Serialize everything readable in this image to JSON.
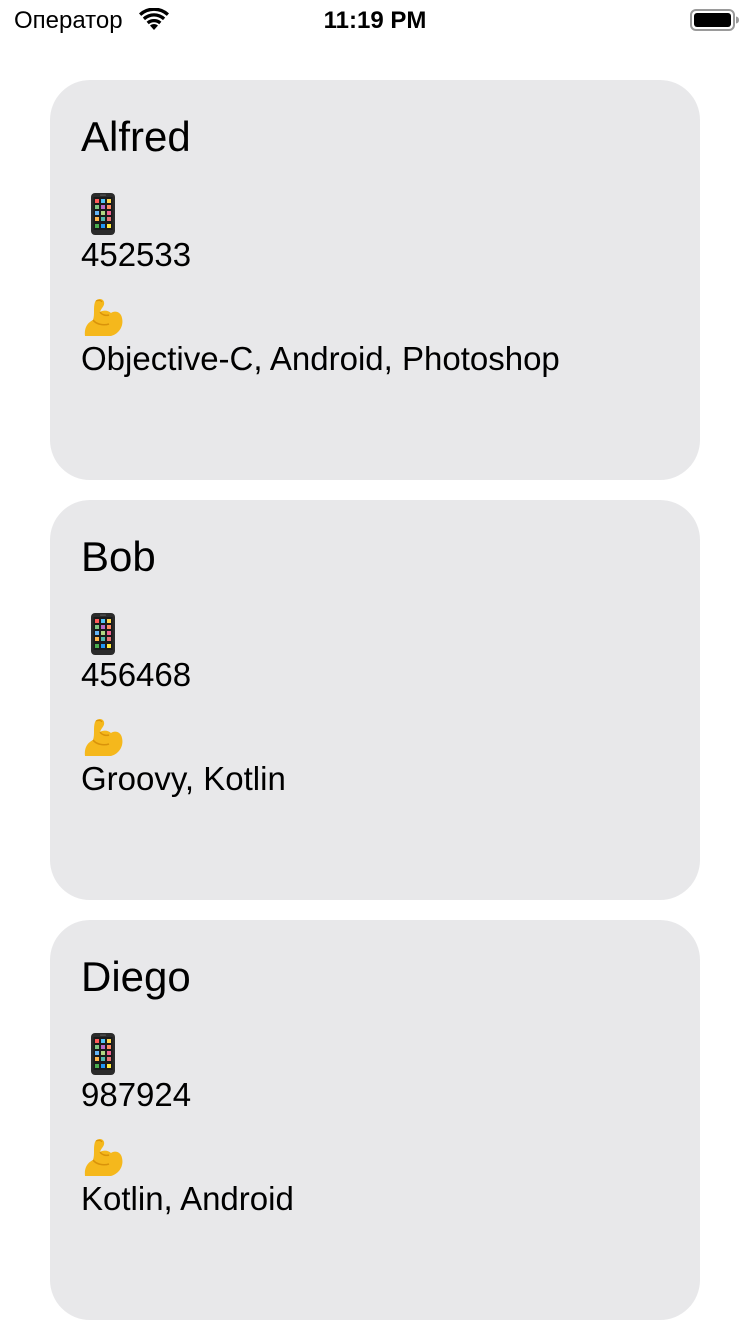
{
  "status_bar": {
    "carrier": "Оператор",
    "time": "11:19 PM"
  },
  "icons": {
    "phone": "mobile-phone-icon",
    "skills": "flexed-biceps-icon",
    "wifi": "wifi-icon",
    "battery": "battery-icon"
  },
  "colors": {
    "card_background": "#e8e8ea",
    "skin": "#f5b81c"
  },
  "people": [
    {
      "name": "Alfred",
      "phone": "452533",
      "skills": "Objective-C, Android, Photoshop"
    },
    {
      "name": "Bob",
      "phone": "456468",
      "skills": "Groovy, Kotlin"
    },
    {
      "name": "Diego",
      "phone": "987924",
      "skills": "Kotlin, Android"
    }
  ]
}
